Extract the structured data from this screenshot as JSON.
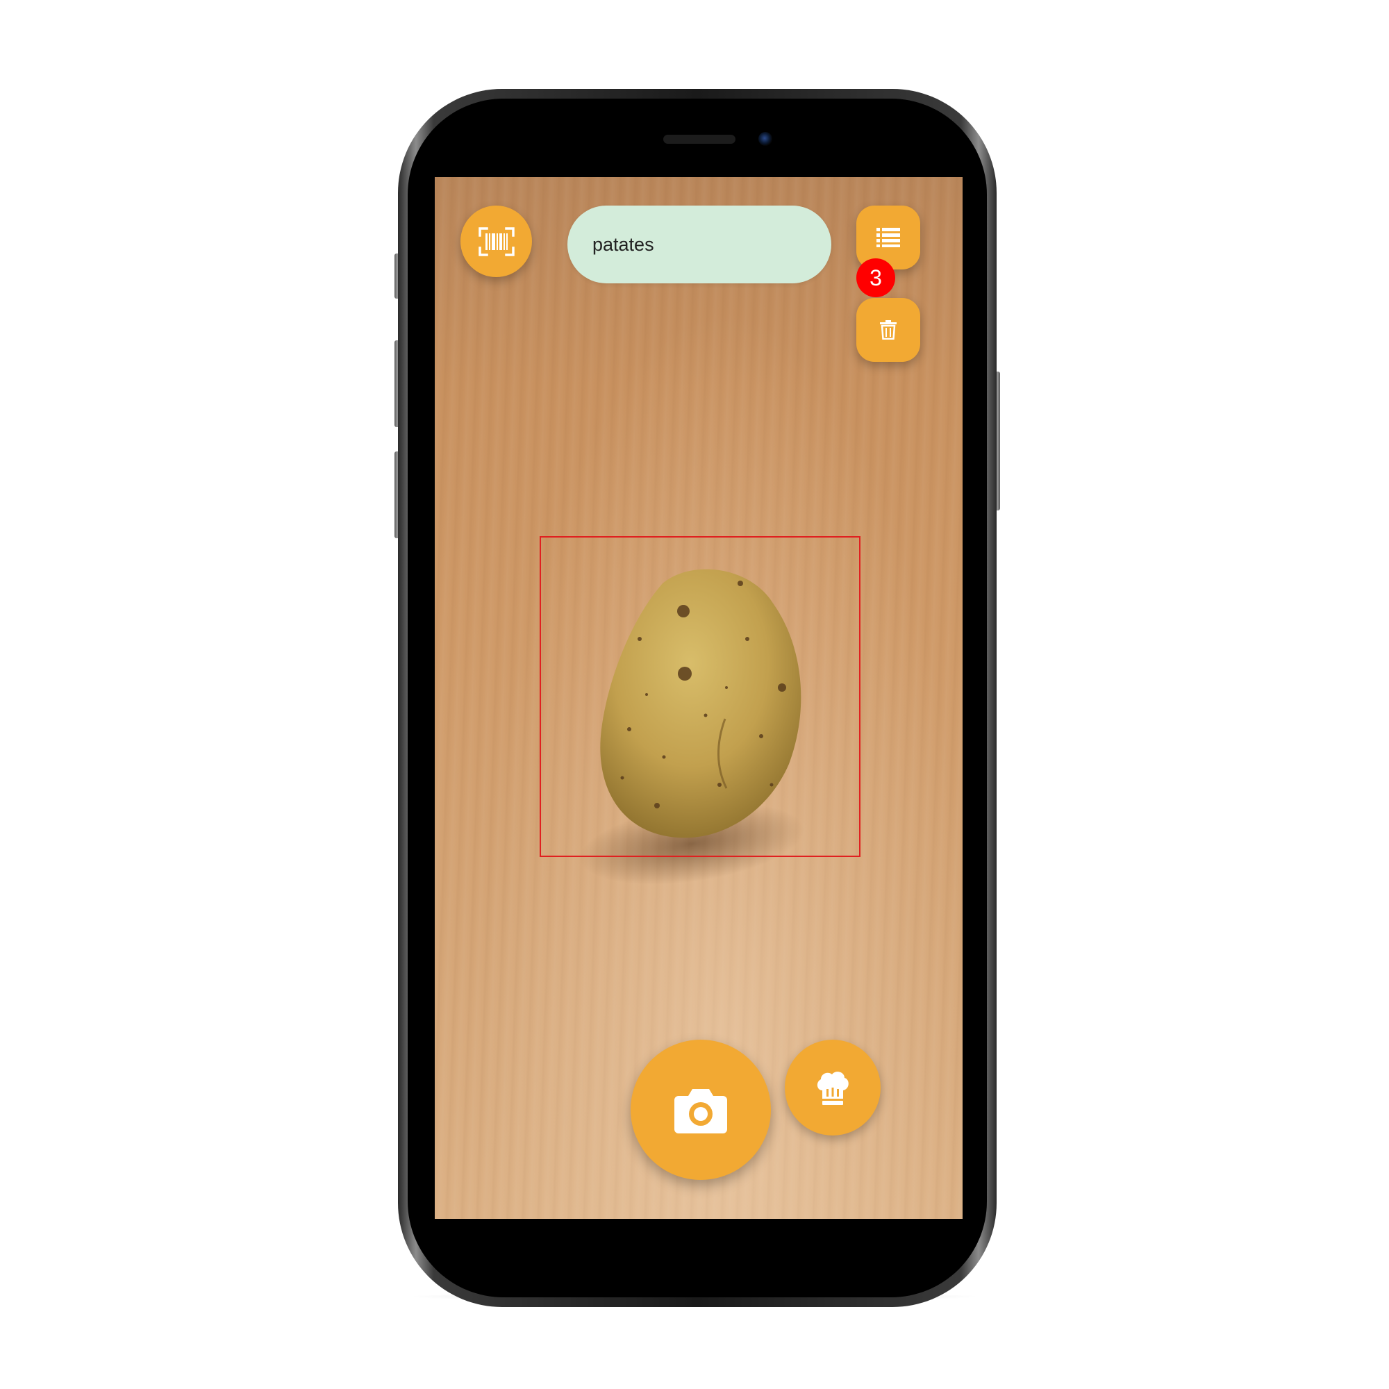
{
  "app": {
    "search_value": "patates",
    "list_badge_count": "3"
  },
  "icons": {
    "barcode": "barcode-scan-icon",
    "list": "list-icon",
    "delete": "trash-icon",
    "camera": "camera-icon",
    "recipe": "chef-hat-icon"
  },
  "colors": {
    "accent": "#f2a933",
    "search_bg": "#d3ecda",
    "badge": "#ff0000",
    "detection_box": "#e02020"
  }
}
